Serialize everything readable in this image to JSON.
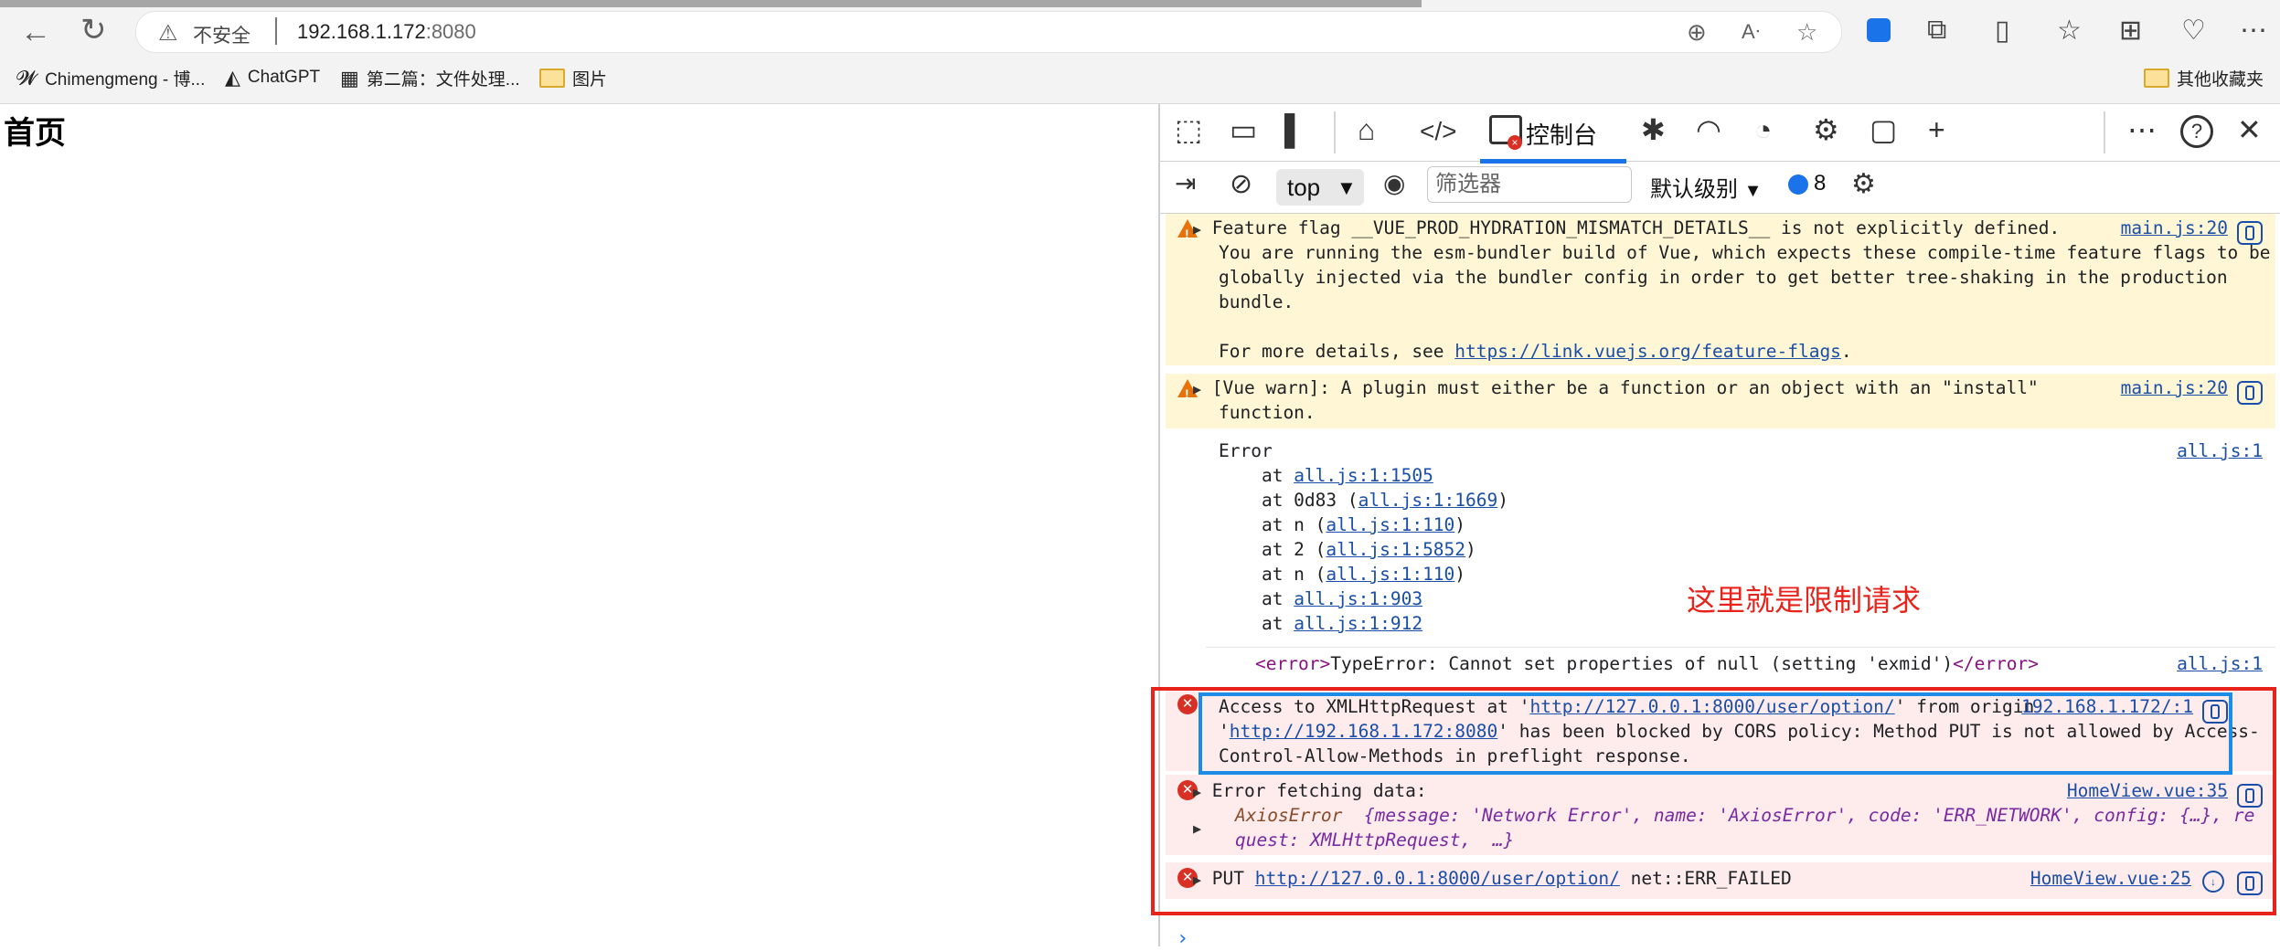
{
  "browser": {
    "insecure_label": "不安全",
    "url_host": "192.168.1.172",
    "url_port": ":8080",
    "bookmarks": [
      {
        "label": "Chimengmeng - 博...",
        "icon": "bird-logo-icon"
      },
      {
        "label": "ChatGPT",
        "icon": "penguin-icon"
      },
      {
        "label": "第二篇：文件处理...",
        "icon": "qr-logo-icon"
      },
      {
        "label": "图片",
        "icon": "folder-icon"
      }
    ],
    "other_bookmarks": "其他收藏夹"
  },
  "page": {
    "heading": "首页"
  },
  "devtools": {
    "console_tab_label": "控制台",
    "console_tab_badge": "×",
    "context": "top",
    "filter_placeholder": "筛选器",
    "level": "默认级别",
    "issues_count": "8",
    "messages": {
      "warn1": {
        "line1": "Feature flag __VUE_PROD_HYDRATION_MISMATCH_DETAILS__ is not explicitly defined.",
        "line2": "You are running the esm-bundler build of Vue, which expects these compile-time feature flags to be",
        "line3": "globally injected via the bundler config in order to get better tree-shaking in the production",
        "line4": "bundle.",
        "line5_prefix": "For more details, see ",
        "line5_link": "https://link.vuejs.org/feature-flags",
        "line5_suffix": ".",
        "source": "main.js:20"
      },
      "warn2": {
        "line1": "[Vue warn]: A plugin must either be a function or an object with an \"install\"",
        "line2": "function.",
        "source": "main.js:20"
      },
      "error_stack": {
        "title": "Error",
        "source": "all.js:1",
        "frames": [
          {
            "prefix": "    at ",
            "link": "all.js:1:1505",
            "suffix": ""
          },
          {
            "prefix": "    at 0d83 (",
            "link": "all.js:1:1669",
            "suffix": ")"
          },
          {
            "prefix": "    at n (",
            "link": "all.js:1:110",
            "suffix": ")"
          },
          {
            "prefix": "    at 2 (",
            "link": "all.js:1:5852",
            "suffix": ")"
          },
          {
            "prefix": "    at n (",
            "link": "all.js:1:110",
            "suffix": ")"
          },
          {
            "prefix": "    at ",
            "link": "all.js:1:903",
            "suffix": ""
          },
          {
            "prefix": "    at ",
            "link": "all.js:1:912",
            "suffix": ""
          }
        ]
      },
      "typeerror": {
        "open_tag": "<error>",
        "text": "TypeError: Cannot set properties of null (setting 'exmid')",
        "close_tag": "</error>",
        "source": "all.js:1"
      },
      "cors": {
        "l1_prefix": "Access to XMLHttpRequest at '",
        "l1_link": "http://127.0.0.1:8000/user/option/",
        "l1_suffix": "' from origin",
        "l2_prefix": "'",
        "l2_link": "http://192.168.1.172:8080",
        "l2_suffix": "' has been blocked by CORS policy: Method PUT is not allowed by Access-",
        "l3": "Control-Allow-Methods in preflight response.",
        "source": "192.168.1.172/:1"
      },
      "fetch_error": {
        "line1": "Error fetching data:",
        "obj_name": "AxiosError",
        "obj_body_1": "{message: 'Network Error', name: 'AxiosError', code: 'ERR_NETWORK', config: {…}, re",
        "obj_body_2": "quest: XMLHttpRequest,  …}",
        "source": "HomeView.vue:35"
      },
      "put_error": {
        "method": "PUT ",
        "link": "http://127.0.0.1:8000/user/option/",
        "suffix": " net::ERR_FAILED",
        "source": "HomeView.vue:25"
      }
    }
  },
  "annotation": "这里就是限制请求",
  "colors": {
    "accent": "#1a73e8",
    "error": "#d93025",
    "warning": "#e8710a",
    "annotation_red": "#e8231b",
    "annotation_blue": "#1c8ce6"
  }
}
